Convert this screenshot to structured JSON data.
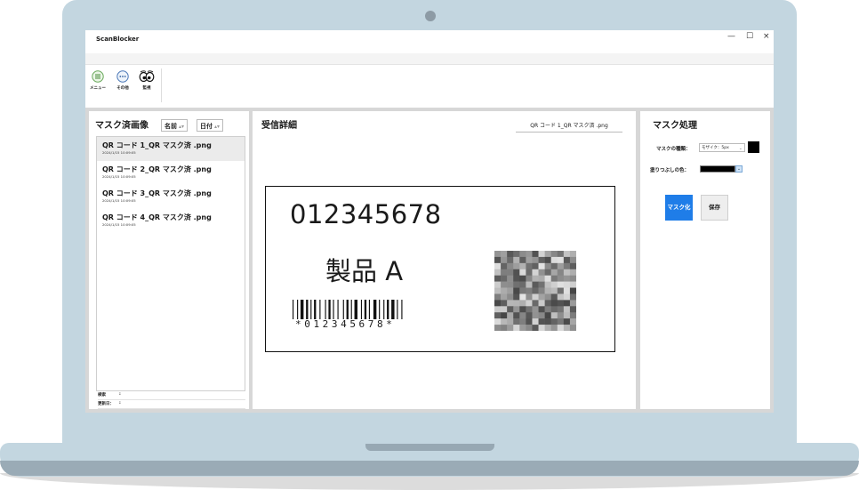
{
  "window": {
    "title": "ScanBlocker",
    "controls": {
      "minimize": "—",
      "maximize": "☐",
      "close": "×"
    }
  },
  "toolbar": {
    "items": [
      {
        "label": "メニュー",
        "icon": "list-icon"
      },
      {
        "label": "その他",
        "icon": "more-icon"
      },
      {
        "label": "監視",
        "icon": "eyes-icon"
      }
    ]
  },
  "left_panel": {
    "title": "マスク済画像",
    "sort_name": "名前",
    "sort_date": "日付",
    "files": [
      {
        "name": "QR コード 1_QR マスク済 .png",
        "date": "2024/1/15 10:09:05",
        "selected": true
      },
      {
        "name": "QR コード 2_QR マスク済 .png",
        "date": "2024/1/15 10:09:05",
        "selected": false
      },
      {
        "name": "QR コード 3_QR マスク済 .png",
        "date": "2024/1/15 10:09:05",
        "selected": false
      },
      {
        "name": "QR コード 4_QR マスク済 .png",
        "date": "2024/1/15 10:09:05",
        "selected": false
      }
    ],
    "meta": {
      "detected_label": "検索",
      "detected_value": ":",
      "updated_label": "更新日：",
      "updated_value": ":"
    }
  },
  "center_panel": {
    "title": "受信詳細",
    "filename": "QR コード 1_QR マスク済 .png",
    "label_number": "012345678",
    "label_product": "製品 A",
    "barcode_text": "*012345678*"
  },
  "right_panel": {
    "title": "マスク処理",
    "mask_type_label": "マスクの種類：",
    "mask_type_value": "モザイク：5px",
    "fill_color_label": "塗りつぶしの色：",
    "fill_color": "#000000",
    "mask_button": "マスク化",
    "save_button": "保存",
    "accent_color": "#1f7de8"
  }
}
